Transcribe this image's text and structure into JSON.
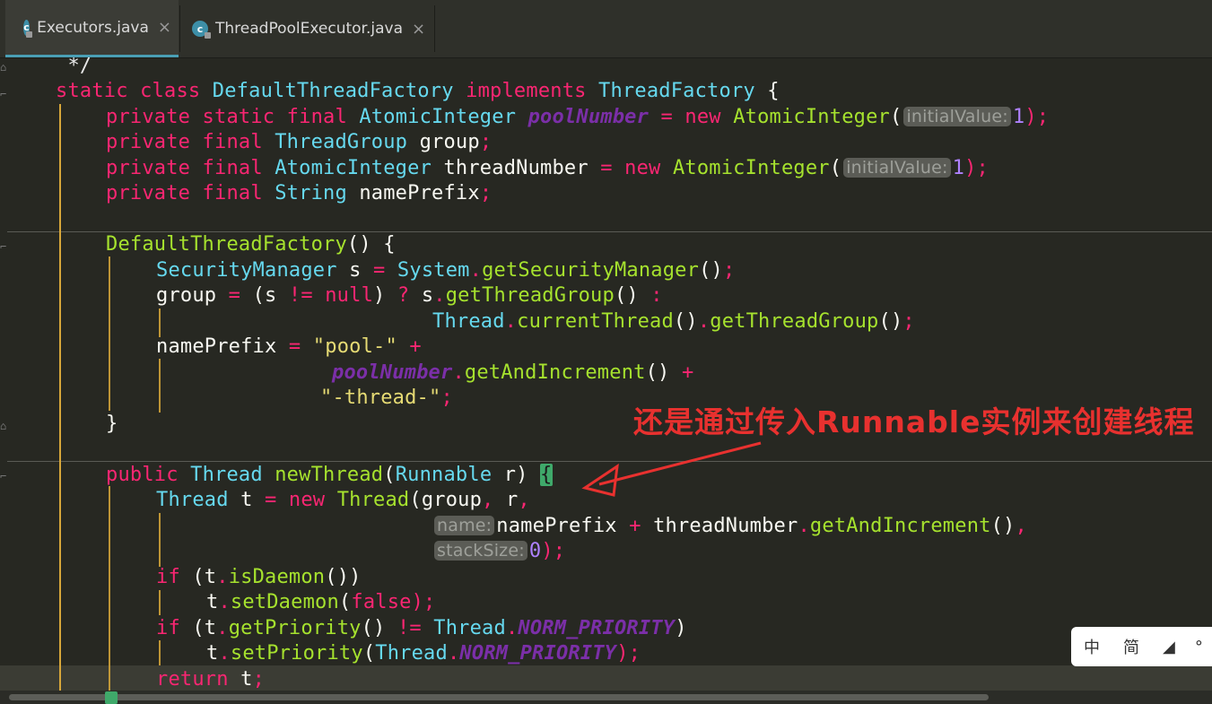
{
  "tabs": [
    {
      "label": "Executors.java",
      "active": true,
      "icon": "java-class-icon"
    },
    {
      "label": "ThreadPoolExecutor.java",
      "active": false,
      "icon": "java-class-icon"
    }
  ],
  "close_glyph": "×",
  "code": {
    "l0": {
      "a": " */"
    },
    "l1": {
      "a": "static class ",
      "b": "DefaultThreadFactory",
      "c": " implements ",
      "d": "ThreadFactory",
      "e": " {"
    },
    "l2": {
      "a": "private static final ",
      "b": "AtomicInteger",
      "c": " poolNumber",
      "d": " = ",
      "e": "new ",
      "f": "AtomicInteger",
      "g": "(",
      "h": "initialValue:",
      "i": "1",
      "j": ");"
    },
    "l3": {
      "a": "private final ",
      "b": "ThreadGroup",
      "c": " group",
      "d": ";"
    },
    "l4": {
      "a": "private final ",
      "b": "AtomicInteger",
      "c": " threadNumber",
      "d": " = ",
      "e": "new ",
      "f": "AtomicInteger",
      "g": "(",
      "h": "initialValue:",
      "i": "1",
      "j": ");"
    },
    "l5": {
      "a": "private final ",
      "b": "String",
      "c": " namePrefix",
      "d": ";"
    },
    "l6": {
      "a": "DefaultThreadFactory",
      "b": "() {"
    },
    "l7": {
      "a": "SecurityManager",
      "b": " s ",
      "c": "=",
      "d": " System",
      "e": ".",
      "f": "getSecurityManager",
      "g": "()",
      "h": ";"
    },
    "l8": {
      "a": "group ",
      "b": "=",
      "c": " (s ",
      "d": "!=",
      "e": " null",
      "f": ") ",
      "g": "?",
      "h": " s",
      "i": ".",
      "j": "getThreadGroup",
      "k": "() ",
      "l": ":"
    },
    "l9": {
      "a": "Thread",
      "b": ".",
      "c": "currentThread",
      "d": "()",
      "e": ".",
      "f": "getThreadGroup",
      "g": "()",
      "h": ";"
    },
    "l10": {
      "a": "namePrefix ",
      "b": "=",
      "c": " \"pool-\"",
      "d": " +"
    },
    "l11": {
      "a": "poolNumber",
      "b": ".",
      "c": "getAndIncrement",
      "d": "() ",
      "e": "+"
    },
    "l12": {
      "a": "\"-thread-\"",
      "b": ";"
    },
    "l13": {
      "a": "}"
    },
    "l14": {
      "a": "public ",
      "b": "Thread",
      "c": " newThread",
      "d": "(",
      "e": "Runnable",
      "f": " r) ",
      "g": "{"
    },
    "l15": {
      "a": "Thread",
      "b": " t ",
      "c": "=",
      "d": " new ",
      "e": "Thread",
      "f": "(group",
      "g": ",",
      "h": " r",
      "i": ","
    },
    "l16": {
      "a": "name:",
      "b": "namePrefix ",
      "c": "+",
      "d": " threadNumber",
      "e": ".",
      "f": "getAndIncrement",
      "g": "()",
      "h": ","
    },
    "l17": {
      "a": "stackSize:",
      "b": "0",
      "c": ");"
    },
    "l18": {
      "a": "if",
      "b": " (t",
      "c": ".",
      "d": "isDaemon",
      "e": "())"
    },
    "l19": {
      "a": "t",
      "b": ".",
      "c": "setDaemon",
      "d": "(",
      "e": "false",
      "f": ");"
    },
    "l20": {
      "a": "if",
      "b": " (t",
      "c": ".",
      "d": "getPriority",
      "e": "() ",
      "f": "!=",
      "g": " Thread",
      "h": ".",
      "i": "NORM_PRIORITY",
      "j": ")"
    },
    "l21": {
      "a": "t",
      "b": ".",
      "c": "setPriority",
      "d": "(",
      "e": "Thread",
      "f": ".",
      "g": "NORM_PRIORITY",
      "h": ");"
    },
    "l22": {
      "a": "return",
      "b": " t",
      "c": ";"
    }
  },
  "annotation": "还是通过传入Runnable实例来创建线程",
  "annotation_color": "#e8312f",
  "ime": {
    "items": [
      "中",
      "简",
      "◢",
      "°"
    ]
  },
  "colors": {
    "background": "#272822",
    "keyword": "#f92672",
    "type": "#66d9ef",
    "function": "#a6e22e",
    "string": "#e6db74",
    "number": "#ae81ff",
    "static_field": "#7b2fa8"
  }
}
